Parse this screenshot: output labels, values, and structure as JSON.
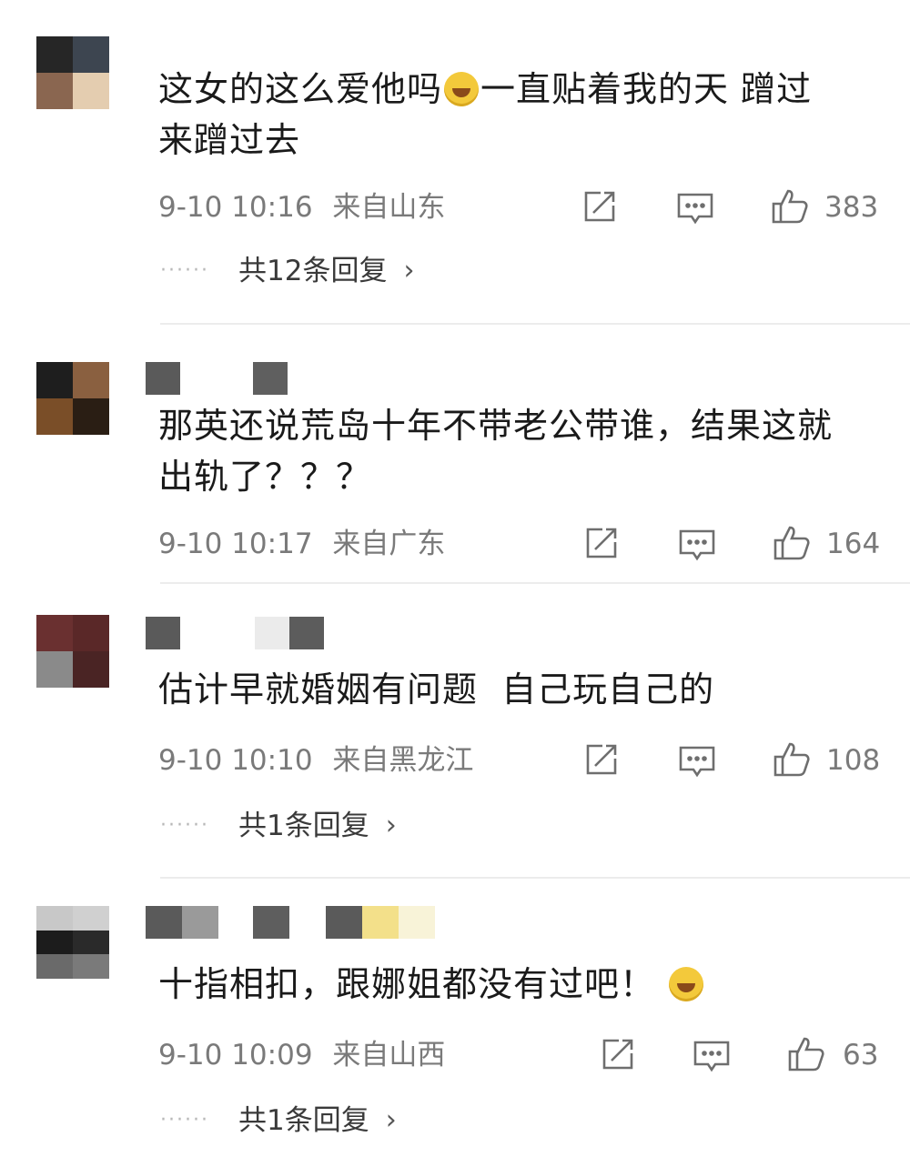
{
  "comments": [
    {
      "text_before": "这女的这么爱他吗",
      "text_after": "一直贴着我的天 蹭过\n来蹭过去",
      "time": "9-10 10:16",
      "location": "来自山东",
      "likes": "383",
      "replies": "共12条回复"
    },
    {
      "text": "那英还说荒岛十年不带老公带谁，结果这就\n出轨了？？？",
      "time": "9-10 10:17",
      "location": "来自广东",
      "likes": "164"
    },
    {
      "text": "估计早就婚姻有问题  自己玩自己的",
      "time": "9-10 10:10",
      "location": "来自黑龙江",
      "likes": "108",
      "replies": "共1条回复"
    },
    {
      "text": "十指相扣，跟娜姐都没有过吧！",
      "time": "9-10 10:09",
      "location": "来自山西",
      "likes": "63",
      "replies": "共1条回复"
    }
  ],
  "icons": {
    "share": "share-icon",
    "comment": "comment-icon",
    "like": "thumbs-up-icon",
    "emoji": "laughing-emoji-icon"
  },
  "colors": {
    "meta_text": "#7a7a7a",
    "body_text": "#1a1a1a",
    "divider": "#ececec"
  }
}
